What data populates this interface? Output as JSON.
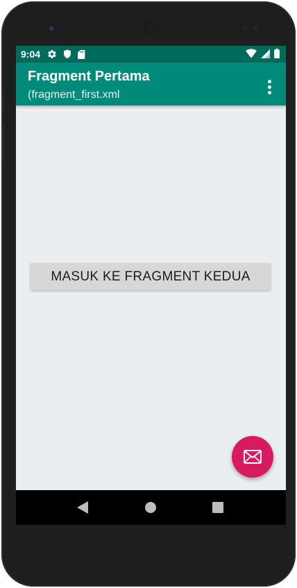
{
  "statusbar": {
    "time": "9:04",
    "left_icons": [
      "gear-icon",
      "shield-icon",
      "sd-card-icon"
    ],
    "right_icons": [
      "wifi-icon",
      "signal-icon",
      "battery-icon"
    ]
  },
  "appbar": {
    "title": "Fragment Pertama",
    "subtitle": "(fragment_first.xml",
    "overflow_icon": "more-vert-icon"
  },
  "main": {
    "button_label": "MASUK KE FRAGMENT KEDUA"
  },
  "fab": {
    "icon": "email-icon"
  },
  "navbar": {
    "icons": [
      "back-icon",
      "home-icon",
      "recents-icon"
    ]
  },
  "colors": {
    "status_bar": "#006a5c",
    "app_bar": "#008a7a",
    "fab": "#d81b60",
    "background": "#ebeef1",
    "button": "#d7d7d7"
  }
}
